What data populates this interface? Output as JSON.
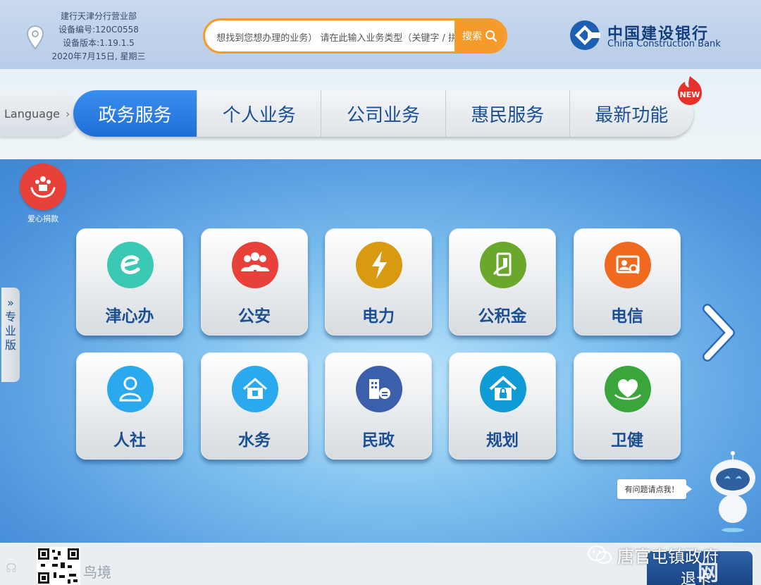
{
  "header": {
    "branch_lines": [
      "建行天津分行营业部",
      "设备编号:120C0558",
      "设备版本:1.19.1.5",
      "2020年7月15日, 星期三"
    ],
    "search_placeholder": "想找到您想办理的业务） 请在此输入业务类型（关键字 / 拼",
    "search_button": "搜索",
    "bank_name_cn": "中国建设银行",
    "bank_name_en": "China Construction Bank"
  },
  "nav": {
    "language": "Language",
    "tabs": [
      {
        "label": "政务服务",
        "active": true
      },
      {
        "label": "个人业务",
        "active": false
      },
      {
        "label": "公司业务",
        "active": false
      },
      {
        "label": "惠民服务",
        "active": false
      },
      {
        "label": "最新功能",
        "active": false
      }
    ],
    "new_badge": "NEW"
  },
  "main": {
    "donate_label": "爱心捐款",
    "pro_tab": [
      "专",
      "业",
      "版"
    ],
    "services": [
      {
        "label": "津心办",
        "icon": "jinxinban-icon",
        "color": "#3cc9b4"
      },
      {
        "label": "公安",
        "icon": "police-icon",
        "color": "#e8413a"
      },
      {
        "label": "电力",
        "icon": "lightning-icon",
        "color": "#d79a10"
      },
      {
        "label": "公积金",
        "icon": "housing-fund-icon",
        "color": "#6aa82b"
      },
      {
        "label": "电信",
        "icon": "telecom-icon",
        "color": "#ef6a1f"
      },
      {
        "label": "人社",
        "icon": "person-icon",
        "color": "#2aa9ee"
      },
      {
        "label": "水务",
        "icon": "water-house-icon",
        "color": "#2aa9ee"
      },
      {
        "label": "民政",
        "icon": "civil-affairs-icon",
        "color": "#3b5faa"
      },
      {
        "label": "规划",
        "icon": "planning-lock-icon",
        "color": "#0e9bd6"
      },
      {
        "label": "卫健",
        "icon": "health-heart-icon",
        "color": "#3aa53a"
      }
    ],
    "chatbot_prompt": "有问题请点我！"
  },
  "footer": {
    "mark_left": "鸟境",
    "watermark_account": "唐官屯镇政府",
    "exit_label": "退卡",
    "corner_mark": "网"
  }
}
